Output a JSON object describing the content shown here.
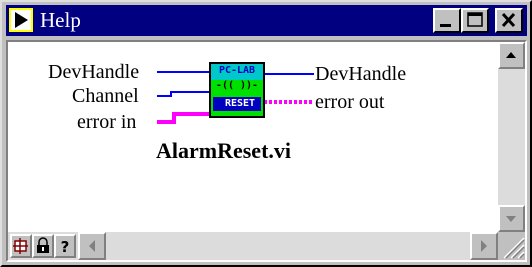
{
  "window": {
    "title": "Help"
  },
  "diagram": {
    "inputs": [
      "DevHandle",
      "Channel",
      "error in"
    ],
    "outputs": [
      "DevHandle",
      "error out"
    ],
    "icon": {
      "line1": "PC-LAB",
      "line2": "-(( ))-",
      "line3": "RESET"
    },
    "vi_name": "AlarmReset.vi"
  },
  "toolbar": [
    "show-detail-icon",
    "lock-icon",
    "help-question-icon"
  ],
  "colors": {
    "titlebar": "#000080",
    "numeric_wire": "#0000ff",
    "error_wire": "#ff00ff",
    "vi_icon_green": "#00e000",
    "vi_icon_cyan": "#00c8c8"
  }
}
